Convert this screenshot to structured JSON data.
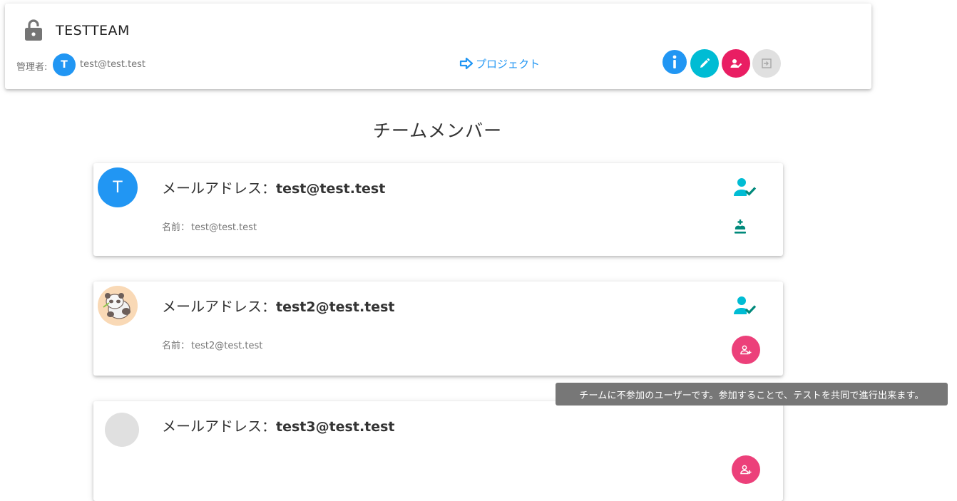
{
  "team": {
    "name": "TESTTEAM",
    "admin_label": "管理者:",
    "admin_avatar_initial": "T",
    "admin_email": "test@test.test",
    "project_link_label": "プロジェクト"
  },
  "members_heading": "チームメンバー",
  "members": [
    {
      "avatar_initial": "T",
      "email_label": "メールアドレス：",
      "email": "test@test.test",
      "name_label": "名前：",
      "name": "test@test.test",
      "status_icon": "user-check-icon",
      "role_icon": "crown-icon"
    },
    {
      "avatar_initial": "",
      "email_label": "メールアドレス：",
      "email": "test2@test.test",
      "name_label": "名前：",
      "name": "test2@test.test",
      "status_icon": "user-check-icon",
      "action_icon": "add-user-icon"
    },
    {
      "avatar_initial": "",
      "email_label": "メールアドレス：",
      "email": "test3@test.test",
      "action_icon": "add-user-icon"
    }
  ],
  "tooltip": "チームに不参加のユーザーです。参加することで、テストを共同で進行出来ます。",
  "colors": {
    "primary": "#2196f3",
    "cyan": "#00bcd4",
    "pink": "#e91e63",
    "pink_light": "#ec407a",
    "teal": "#00897b",
    "grey": "#e0e0e0"
  }
}
